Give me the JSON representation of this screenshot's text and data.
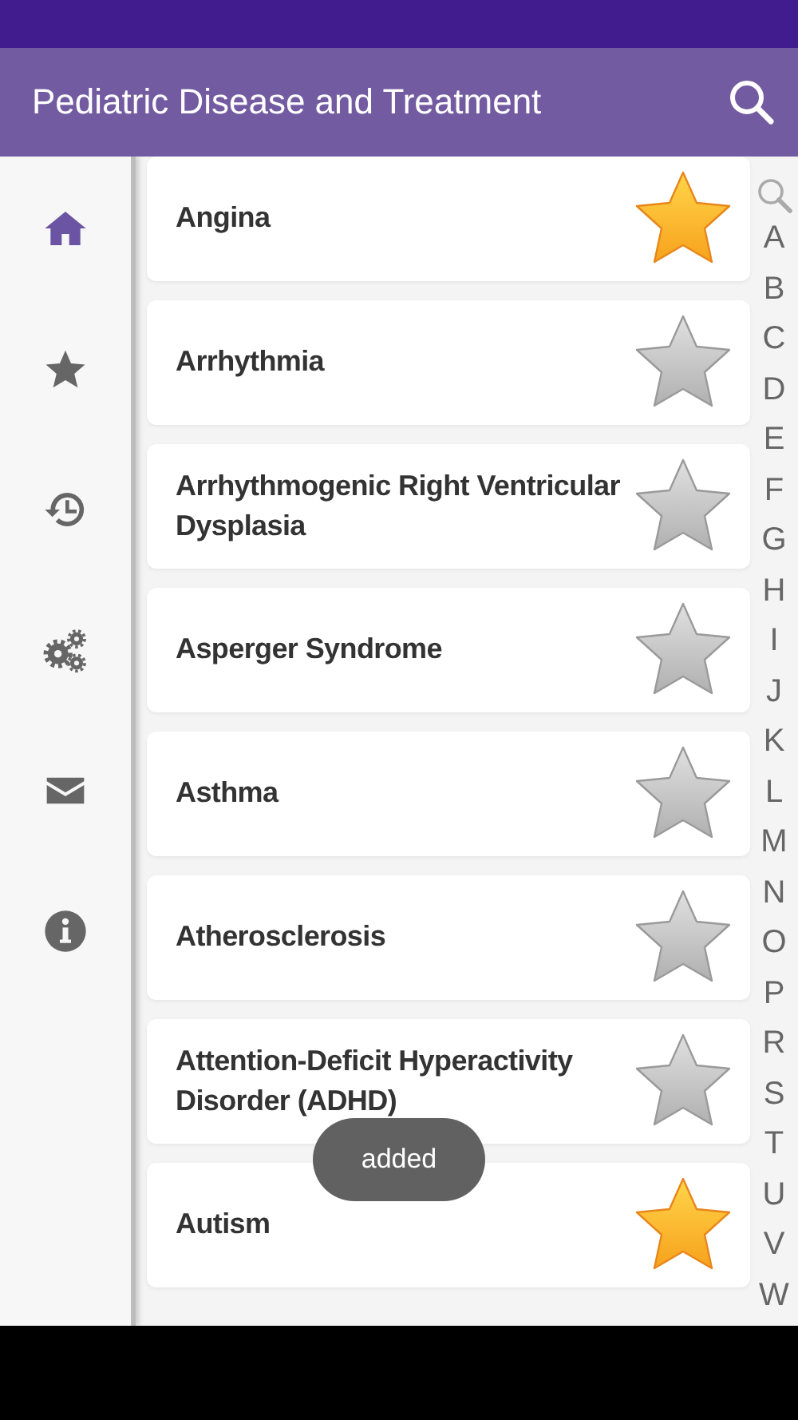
{
  "app_bar": {
    "title": "Pediatric Disease and Treatment"
  },
  "sidebar": {
    "items": [
      {
        "kind": "home",
        "selected": true
      },
      {
        "kind": "favorites",
        "selected": false
      },
      {
        "kind": "history",
        "selected": false
      },
      {
        "kind": "settings",
        "selected": false
      },
      {
        "kind": "mail",
        "selected": false
      },
      {
        "kind": "info",
        "selected": false
      }
    ]
  },
  "diseases": [
    {
      "name": "Angina",
      "favorite": true
    },
    {
      "name": "Arrhythmia",
      "favorite": false
    },
    {
      "name": "Arrhythmogenic Right Ventricular Dysplasia",
      "favorite": false
    },
    {
      "name": "Asperger Syndrome",
      "favorite": false
    },
    {
      "name": "Asthma",
      "favorite": false
    },
    {
      "name": "Atherosclerosis",
      "favorite": false
    },
    {
      "name": "Attention-Deficit Hyperactivity Disorder (ADHD)",
      "favorite": false
    },
    {
      "name": "Autism",
      "favorite": true
    }
  ],
  "index": [
    "A",
    "B",
    "C",
    "D",
    "E",
    "F",
    "G",
    "H",
    "I",
    "J",
    "K",
    "L",
    "M",
    "N",
    "O",
    "P",
    "R",
    "S",
    "T",
    "U",
    "V",
    "W"
  ],
  "toast": "added"
}
